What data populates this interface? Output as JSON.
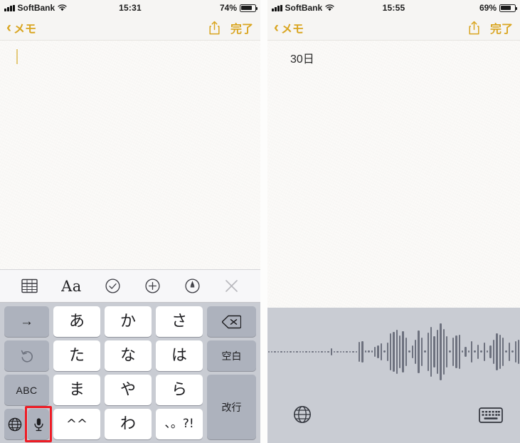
{
  "panels": [
    {
      "id": "left",
      "status_bar": {
        "carrier": "SoftBank",
        "time": "15:31",
        "battery_percent": "74%",
        "battery_level": 74,
        "signal_icon": "signal-bars-icon",
        "wifi_icon": "wifi-icon",
        "battery_icon": "battery-icon"
      },
      "nav_bar": {
        "back_icon": "chevron-left-icon",
        "back_label": "メモ",
        "share_icon": "share-icon",
        "done_label": "完了"
      },
      "note": {
        "text": "",
        "caret_visible": true
      },
      "keyboard_toolbar": {
        "items": [
          {
            "name": "table-icon",
            "label": ""
          },
          {
            "name": "text-format-icon",
            "label": "Aa"
          },
          {
            "name": "checklist-icon",
            "label": ""
          },
          {
            "name": "add-attachment-icon",
            "label": ""
          },
          {
            "name": "markup-pen-icon",
            "label": ""
          },
          {
            "name": "close-icon",
            "label": ""
          }
        ]
      },
      "keyboard": {
        "type": "japanese-kana-keypad",
        "keys": [
          {
            "name": "key-next-candidate",
            "label": "→",
            "style": "gray"
          },
          {
            "name": "key-a-row",
            "label": "あ",
            "style": "white"
          },
          {
            "name": "key-ka-row",
            "label": "か",
            "style": "white"
          },
          {
            "name": "key-sa-row",
            "label": "さ",
            "style": "white"
          },
          {
            "name": "key-delete",
            "label": "⌫",
            "style": "gray"
          },
          {
            "name": "key-undo",
            "label": "↺",
            "style": "gray"
          },
          {
            "name": "key-ta-row",
            "label": "た",
            "style": "white"
          },
          {
            "name": "key-na-row",
            "label": "な",
            "style": "white"
          },
          {
            "name": "key-ha-row",
            "label": "は",
            "style": "white"
          },
          {
            "name": "key-space",
            "label": "空白",
            "style": "gray"
          },
          {
            "name": "key-abc-mode",
            "label": "ABC",
            "style": "gray"
          },
          {
            "name": "key-ma-row",
            "label": "ま",
            "style": "white"
          },
          {
            "name": "key-ya-row",
            "label": "や",
            "style": "white"
          },
          {
            "name": "key-ra-row",
            "label": "ら",
            "style": "white"
          },
          {
            "name": "key-return",
            "label": "改行",
            "style": "gray"
          },
          {
            "name": "key-globe",
            "label": "",
            "style": "gray"
          },
          {
            "name": "key-dictation-mic",
            "label": "",
            "style": "gray"
          },
          {
            "name": "key-emoticon",
            "label": "^^",
            "style": "white"
          },
          {
            "name": "key-wa-row",
            "label": "わ",
            "style": "white"
          },
          {
            "name": "key-punctuation",
            "label": "、。?!",
            "style": "white"
          }
        ],
        "highlight": {
          "target": "key-dictation-mic",
          "color": "#ee1c25"
        }
      }
    },
    {
      "id": "right",
      "status_bar": {
        "carrier": "SoftBank",
        "time": "15:55",
        "battery_percent": "69%",
        "battery_level": 69,
        "signal_icon": "signal-bars-icon",
        "wifi_icon": "wifi-icon",
        "battery_icon": "battery-icon"
      },
      "nav_bar": {
        "back_icon": "chevron-left-icon",
        "back_label": "メモ",
        "share_icon": "share-icon",
        "done_label": "完了"
      },
      "note": {
        "text": "30日",
        "caret_visible": false
      },
      "dictation": {
        "state": "listening",
        "waveform_heights": [
          2,
          2,
          2,
          2,
          2,
          2,
          2,
          2,
          2,
          2,
          2,
          2,
          2,
          2,
          2,
          2,
          2,
          2,
          2,
          2,
          2,
          2,
          2,
          2,
          2,
          2,
          2,
          2,
          2,
          2,
          2,
          2,
          2,
          2,
          10,
          2,
          2,
          2,
          2,
          2,
          2,
          2,
          2,
          28,
          30,
          3,
          3,
          3,
          14,
          18,
          24,
          3,
          26,
          52,
          56,
          62,
          46,
          58,
          40,
          3,
          18,
          34,
          60,
          40,
          3,
          54,
          70,
          44,
          62,
          80,
          64,
          44,
          3,
          40,
          46,
          48,
          3,
          14,
          3,
          30,
          3,
          20,
          3,
          26,
          3,
          18,
          34,
          52,
          48,
          40,
          3,
          26,
          3,
          30,
          34,
          26,
          3,
          3,
          18,
          24,
          3,
          3,
          3,
          3,
          3,
          3,
          3,
          3,
          3
        ],
        "globe_icon": "globe-icon",
        "keyboard_icon": "keyboard-icon"
      }
    }
  ],
  "colors": {
    "accent_gold": "#d9a520",
    "keyboard_bg": "#c9ccd3",
    "key_gray": "#adb2bd",
    "highlight_red": "#ee1c25",
    "note_paper": "#fbfaf8"
  }
}
